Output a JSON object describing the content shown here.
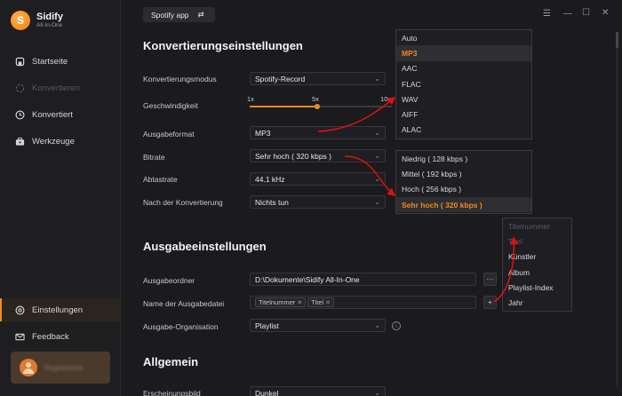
{
  "app": {
    "name": "Sidify",
    "subtitle": "All-In-One"
  },
  "sidebar": {
    "items": [
      {
        "label": "Startseite",
        "icon": "home-icon"
      },
      {
        "label": "Konvertieren",
        "icon": "convert-icon",
        "disabled": true
      },
      {
        "label": "Konvertiert",
        "icon": "clock-icon"
      },
      {
        "label": "Werkzeuge",
        "icon": "toolbox-icon"
      },
      {
        "label": "Einstellungen",
        "icon": "settings-icon",
        "active": true
      },
      {
        "label": "Feedback",
        "icon": "mail-icon"
      }
    ],
    "user": {
      "name": "Registrieren"
    }
  },
  "topbar": {
    "source": "Spotify app",
    "swap_icon": "swap-icon"
  },
  "conversion": {
    "title": "Konvertierungseinstellungen",
    "mode_label": "Konvertierungsmodus",
    "mode_value": "Spotify-Record",
    "speed_label": "Geschwindigkeit",
    "speed_ticks": [
      "1x",
      "5x",
      "10x"
    ],
    "speed_value": "5x",
    "format_label": "Ausgabeformat",
    "format_value": "MP3",
    "bitrate_label": "Bitrate",
    "bitrate_value": "Sehr hoch ( 320 kbps )",
    "samplerate_label": "Abtastrate",
    "samplerate_value": "44.1 kHz",
    "after_label": "Nach der Konvertierung",
    "after_value": "Nichts tun"
  },
  "format_dropdown": {
    "options": [
      "Auto",
      "MP3",
      "AAC",
      "FLAC",
      "WAV",
      "AIFF",
      "ALAC"
    ],
    "selected": "MP3"
  },
  "bitrate_dropdown": {
    "options": [
      "Niedrig ( 128 kbps )",
      "Mittel ( 192 kbps )",
      "Hoch ( 256 kbps )",
      "Sehr hoch ( 320 kbps )"
    ],
    "selected": "Sehr hoch ( 320 kbps )"
  },
  "output": {
    "title": "Ausgabeeinstellungen",
    "folder_label": "Ausgabeordner",
    "folder_value": "D:\\Dokumente\\Sidify All-In-One",
    "browse_label": "···",
    "filename_label": "Name der Ausgabedatei",
    "filename_tags": [
      "Titelnummer",
      "Titel"
    ],
    "add_label": "+",
    "org_label": "Ausgabe-Organisation",
    "org_value": "Playlist",
    "info_label": "i"
  },
  "name_dropdown": {
    "options": [
      {
        "label": "Titelnummer",
        "disabled": true
      },
      {
        "label": "Titel",
        "disabled": true
      },
      {
        "label": "Künstler",
        "disabled": false
      },
      {
        "label": "Album",
        "disabled": false
      },
      {
        "label": "Playlist-Index",
        "disabled": false
      },
      {
        "label": "Jahr",
        "disabled": false
      }
    ]
  },
  "general": {
    "title": "Allgemein",
    "appearance_label": "Erscheinungsbild",
    "appearance_value": "Dunkel"
  },
  "colors": {
    "accent": "#f08a1c",
    "arrow": "#e01010",
    "background": "#1b1b1e",
    "sidebar": "#1e1e21"
  }
}
